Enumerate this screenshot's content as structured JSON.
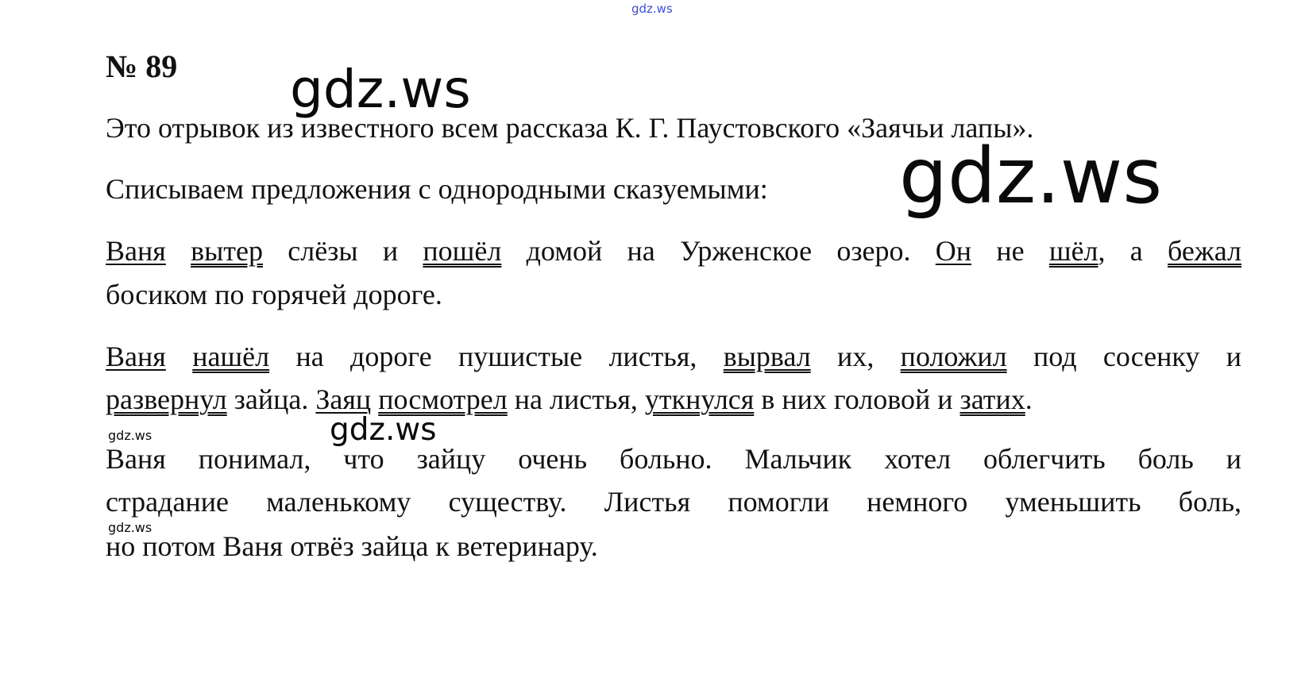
{
  "watermarks": {
    "top": "gdz.ws",
    "large_1": "gdz.ws",
    "large_2": "gdz.ws",
    "medium": "gdz.ws",
    "small_1": "gdz.ws",
    "small_2": "gdz.ws"
  },
  "task_number": "№ 89",
  "intro": "Это отрывок из известного всем рассказа К. Г. Паустовского «Заячьи лапы».",
  "instruction": "Списываем предложения с однородными сказуемыми:",
  "sentences_1": {
    "line_a": [
      {
        "text": "Ваня",
        "underline": "single"
      },
      {
        "text": " "
      },
      {
        "text": "вытер",
        "underline": "double"
      },
      {
        "text": " слёзы и "
      },
      {
        "text": "пошёл",
        "underline": "double"
      },
      {
        "text": " домой на Урженское озеро. "
      },
      {
        "text": "Он",
        "underline": "single"
      },
      {
        "text": " не "
      },
      {
        "text": "шёл",
        "underline": "double"
      },
      {
        "text": ", а "
      },
      {
        "text": "бежал",
        "underline": "double"
      }
    ],
    "line_b": "босиком по горячей дороге."
  },
  "sentences_2": {
    "line_a": [
      {
        "text": "Ваня",
        "underline": "single"
      },
      {
        "text": " "
      },
      {
        "text": "нашёл",
        "underline": "double"
      },
      {
        "text": " на дороге пушистые листья, "
      },
      {
        "text": "вырвал",
        "underline": "double"
      },
      {
        "text": " их, "
      },
      {
        "text": "положил",
        "underline": "double"
      },
      {
        "text": " под сосенку и"
      }
    ],
    "line_b": [
      {
        "text": "развернул",
        "underline": "double"
      },
      {
        "text": " зайца. "
      },
      {
        "text": "Заяц",
        "underline": "single"
      },
      {
        "text": " "
      },
      {
        "text": "посмотрел",
        "underline": "double"
      },
      {
        "text": " на листья, "
      },
      {
        "text": "уткнулся",
        "underline": "double"
      },
      {
        "text": " в них головой и "
      },
      {
        "text": "затих",
        "underline": "double"
      },
      {
        "text": "."
      }
    ]
  },
  "conclusion": {
    "line_a": "Ваня понимал, что зайцу очень больно. Мальчик хотел облегчить боль и",
    "line_b": "страдание маленькому существу. Листья помогли немного уменьшить боль,",
    "line_c": "но потом Ваня отвёз зайца к ветеринару."
  }
}
